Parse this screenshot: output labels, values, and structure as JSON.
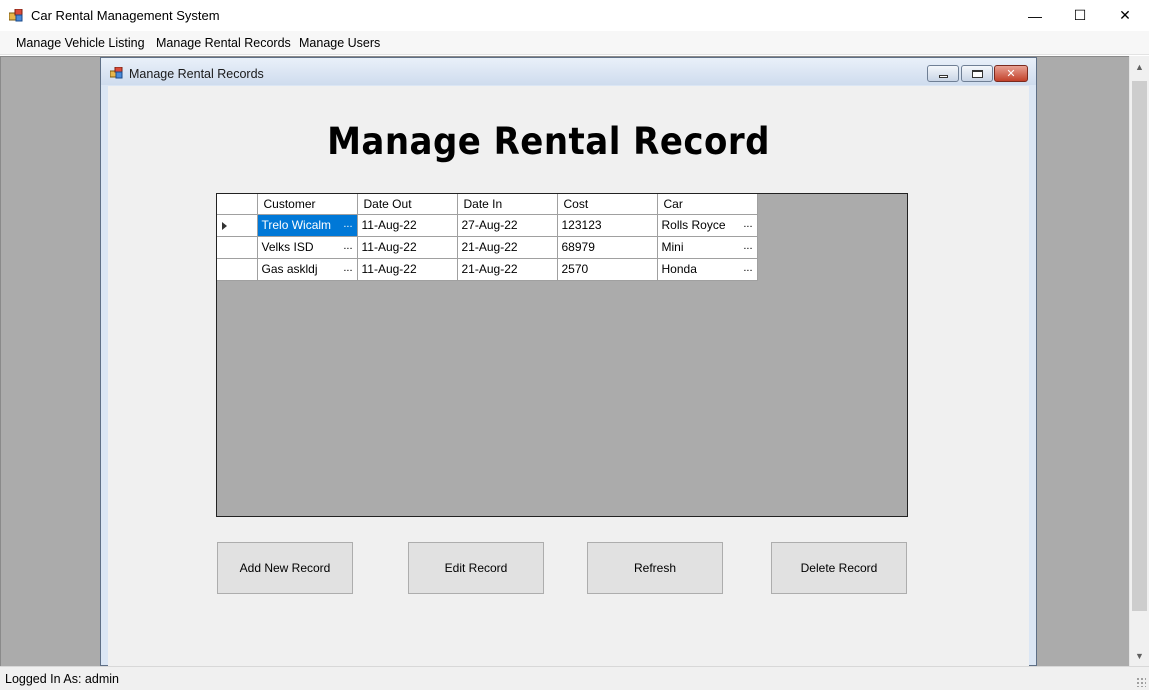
{
  "window": {
    "title": "Car Rental Management System",
    "controls": {
      "minimize": "—",
      "maximize": "☐",
      "close": "✕"
    }
  },
  "menu": {
    "items": [
      "Manage Vehicle Listing",
      "Manage Rental Records",
      "Manage Users"
    ]
  },
  "child_window": {
    "title": "Manage Rental Records",
    "heading": "Manage Rental Record"
  },
  "grid": {
    "columns": [
      "Customer",
      "Date Out",
      "Date In",
      "Cost",
      "Car"
    ],
    "rows": [
      {
        "customer": "Trelo Wicalm",
        "date_out": "11-Aug-22",
        "date_in": "27-Aug-22",
        "cost": "123123",
        "car": "Rolls Royce",
        "selected": true
      },
      {
        "customer": "Velks ISD",
        "date_out": "11-Aug-22",
        "date_in": "21-Aug-22",
        "cost": "68979",
        "car": "Mini",
        "selected": false
      },
      {
        "customer": "Gas askldj",
        "date_out": "11-Aug-22",
        "date_in": "21-Aug-22",
        "cost": "2570",
        "car": "Honda",
        "selected": false
      }
    ],
    "ellipsis": "..."
  },
  "buttons": {
    "add": "Add New Record",
    "edit": "Edit Record",
    "refresh": "Refresh",
    "delete": "Delete Record"
  },
  "status": {
    "text": "Logged In As: admin"
  },
  "colors": {
    "selection": "#0078d7",
    "mdi_background": "#ababab",
    "client_background": "#f0f0f0"
  },
  "icons": [
    "app-icon",
    "child-window-icon",
    "row-pointer-icon",
    "scroll-up-icon",
    "scroll-down-icon",
    "resize-grip-icon"
  ]
}
